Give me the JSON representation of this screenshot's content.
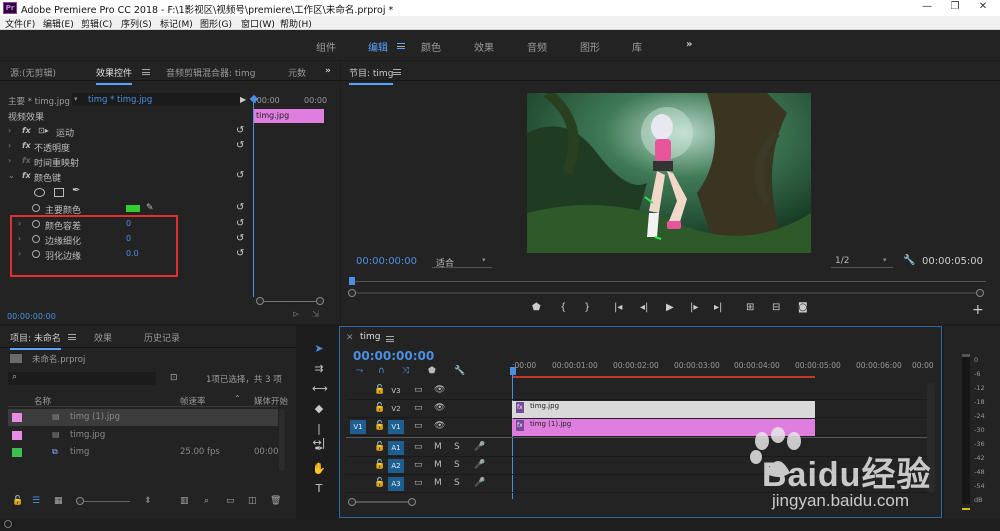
{
  "window": {
    "title": "Adobe Premiere Pro CC 2018 - F:\\1影视区\\视频号\\premiere\\工作区\\未命名.prproj *",
    "app_icon": "Pr"
  },
  "menu": [
    "文件(F)",
    "编辑(E)",
    "剪辑(C)",
    "序列(S)",
    "标记(M)",
    "图形(G)",
    "窗口(W)",
    "帮助(H)"
  ],
  "workspaces": [
    "组件",
    "编辑",
    "颜色",
    "效果",
    "音频",
    "图形",
    "库"
  ],
  "workspace_active": "编辑",
  "source_panel": {
    "tabs": [
      "源:(无剪辑)",
      "效果控件",
      "音频剪辑混合器: timg",
      "元数"
    ],
    "master_label": "主要 * timg.jpg",
    "clip_label": "timg * timg.jpg",
    "ruler_start": ":00:00",
    "ruler_end": "00:00",
    "clip_name": "timg.jpg",
    "section_header": "视频效果",
    "effects": [
      "运动",
      "不透明度",
      "时间重映射",
      "颜色键"
    ],
    "key_color_label": "主要颜色",
    "key_color": "#33cc33",
    "params": [
      {
        "label": "颜色容差",
        "value": "0"
      },
      {
        "label": "边缘细化",
        "value": "0"
      },
      {
        "label": "羽化边缘",
        "value": "0.0"
      }
    ],
    "timecode": "00:00:00:00"
  },
  "program": {
    "title": "节目: timg",
    "timecode": "00:00:00:00",
    "fit_label": "适合",
    "resolution": "1/2",
    "duration": "00:00:05:00"
  },
  "project": {
    "tabs": [
      "项目: 未命名",
      "效果",
      "历史记录"
    ],
    "filename": "未命名.prproj",
    "selection_info": "1项已选择，共 3 项",
    "col_name": "名称",
    "col_fps": "帧速率",
    "col_media": "媒体开始",
    "items": [
      {
        "name": "timg (1).jpg",
        "fps": "",
        "media": "",
        "color": "#e58ce5",
        "selected": true
      },
      {
        "name": "timg.jpg",
        "fps": "",
        "media": "",
        "color": "#e58ce5",
        "selected": false
      },
      {
        "name": "timg",
        "fps": "25.00 fps",
        "media": "00:00:",
        "color": "#3fbf4f",
        "selected": false
      }
    ]
  },
  "timeline": {
    "title": "timg",
    "timecode": "00:00:00:00",
    "ruler": [
      ":00:00",
      "00:00:01:00",
      "00:00:02:00",
      "00:00:03:00",
      "00:00:04:00",
      "00:00:05:00",
      "00:00:06:00",
      "00:00"
    ],
    "tracks": [
      {
        "src": "",
        "name": "V3",
        "kind": "video",
        "on": false
      },
      {
        "src": "",
        "name": "V2",
        "kind": "video",
        "on": false
      },
      {
        "src": "V1",
        "name": "V1",
        "kind": "video",
        "on": true
      },
      {
        "src": "",
        "name": "A1",
        "kind": "audio",
        "on": true
      },
      {
        "src": "",
        "name": "A2",
        "kind": "audio",
        "on": true
      },
      {
        "src": "",
        "name": "A3",
        "kind": "audio",
        "on": true
      }
    ],
    "clips": [
      {
        "track": "V2",
        "label": "timg.jpg",
        "color": "#d9d9d9"
      },
      {
        "track": "V1",
        "label": "timg (1).jpg",
        "color": "#e07ee0"
      }
    ]
  },
  "meter": {
    "labels": [
      "0",
      "-6",
      "-12",
      "-18",
      "-24",
      "-30",
      "-36",
      "-42",
      "-48",
      "-54",
      "dB"
    ]
  },
  "watermark": {
    "brand": "Baidu经验",
    "url": "jingyan.baidu.com"
  }
}
